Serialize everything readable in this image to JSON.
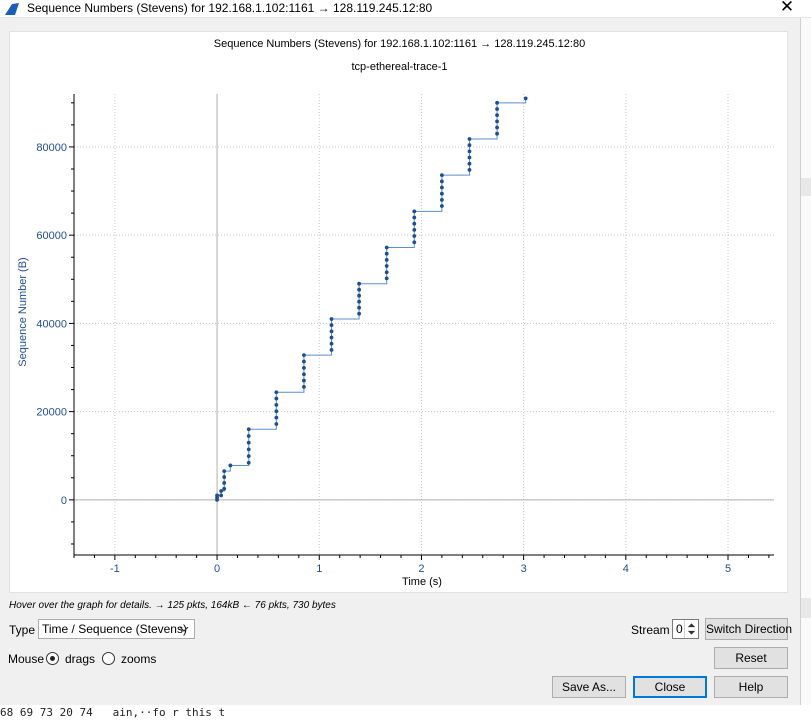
{
  "window": {
    "title": "Sequence Numbers (Stevens) for 192.168.1.102:1161 → 128.119.245.12:80",
    "close_glyph": "✕"
  },
  "chart_data": {
    "type": "scatter",
    "title": "Sequence Numbers (Stevens) for 192.168.1.102:1161 → 128.119.245.12:80",
    "subtitle": "tcp-ethereal-trace-1",
    "xlabel": "Time (s)",
    "ylabel": "Sequence Number (B)",
    "xlim": [
      -1.4,
      5.45
    ],
    "ylim": [
      -12500,
      92000
    ],
    "xticks": [
      -1,
      0,
      1,
      2,
      3,
      4,
      5
    ],
    "yticks": [
      0,
      20000,
      40000,
      60000,
      80000
    ],
    "grid": true,
    "marker_color": "#1f4e8c",
    "step_line_color": "#5b8fc9",
    "axis_text_color": "#1f4e8c",
    "bursts": [
      {
        "t": 0.0,
        "y_start": 0,
        "y_end": 1000,
        "count": 3
      },
      {
        "t": 0.04,
        "y_start": 1000,
        "y_end": 2000,
        "count": 2
      },
      {
        "t": 0.07,
        "y_start": 2500,
        "y_end": 6500,
        "count": 4
      },
      {
        "t": 0.13,
        "y_start": 7800,
        "y_end": 7800,
        "count": 1
      },
      {
        "t": 0.31,
        "y_start": 8400,
        "y_end": 16000,
        "count": 6
      },
      {
        "t": 0.58,
        "y_start": 17200,
        "y_end": 24400,
        "count": 6
      },
      {
        "t": 0.85,
        "y_start": 25600,
        "y_end": 32800,
        "count": 6
      },
      {
        "t": 1.12,
        "y_start": 34000,
        "y_end": 41000,
        "count": 6
      },
      {
        "t": 1.39,
        "y_start": 42200,
        "y_end": 49000,
        "count": 6
      },
      {
        "t": 1.66,
        "y_start": 50200,
        "y_end": 57200,
        "count": 6
      },
      {
        "t": 1.93,
        "y_start": 58400,
        "y_end": 65400,
        "count": 6
      },
      {
        "t": 2.2,
        "y_start": 66600,
        "y_end": 73600,
        "count": 6
      },
      {
        "t": 2.47,
        "y_start": 74800,
        "y_end": 81800,
        "count": 6
      },
      {
        "t": 2.74,
        "y_start": 83000,
        "y_end": 90000,
        "count": 6
      },
      {
        "t": 3.02,
        "y_start": 91000,
        "y_end": 91000,
        "count": 1
      }
    ]
  },
  "hint": {
    "text": "Hover over the graph for details. → 125 pkts, 164kB ← 76 pkts, 730 bytes"
  },
  "controls": {
    "type_label": "Type",
    "type_value": "Time / Sequence (Stevens)",
    "stream_label": "Stream",
    "stream_value": "0",
    "switch_direction": "Switch Direction",
    "mouse_label": "Mouse",
    "drags_label": "drags",
    "zooms_label": "zooms",
    "mouse_mode": "drags",
    "reset": "Reset",
    "save_as": "Save As...",
    "close": "Close",
    "help": "Help"
  },
  "background_text": "68 69 73 20 74   ain,··fo r this t"
}
